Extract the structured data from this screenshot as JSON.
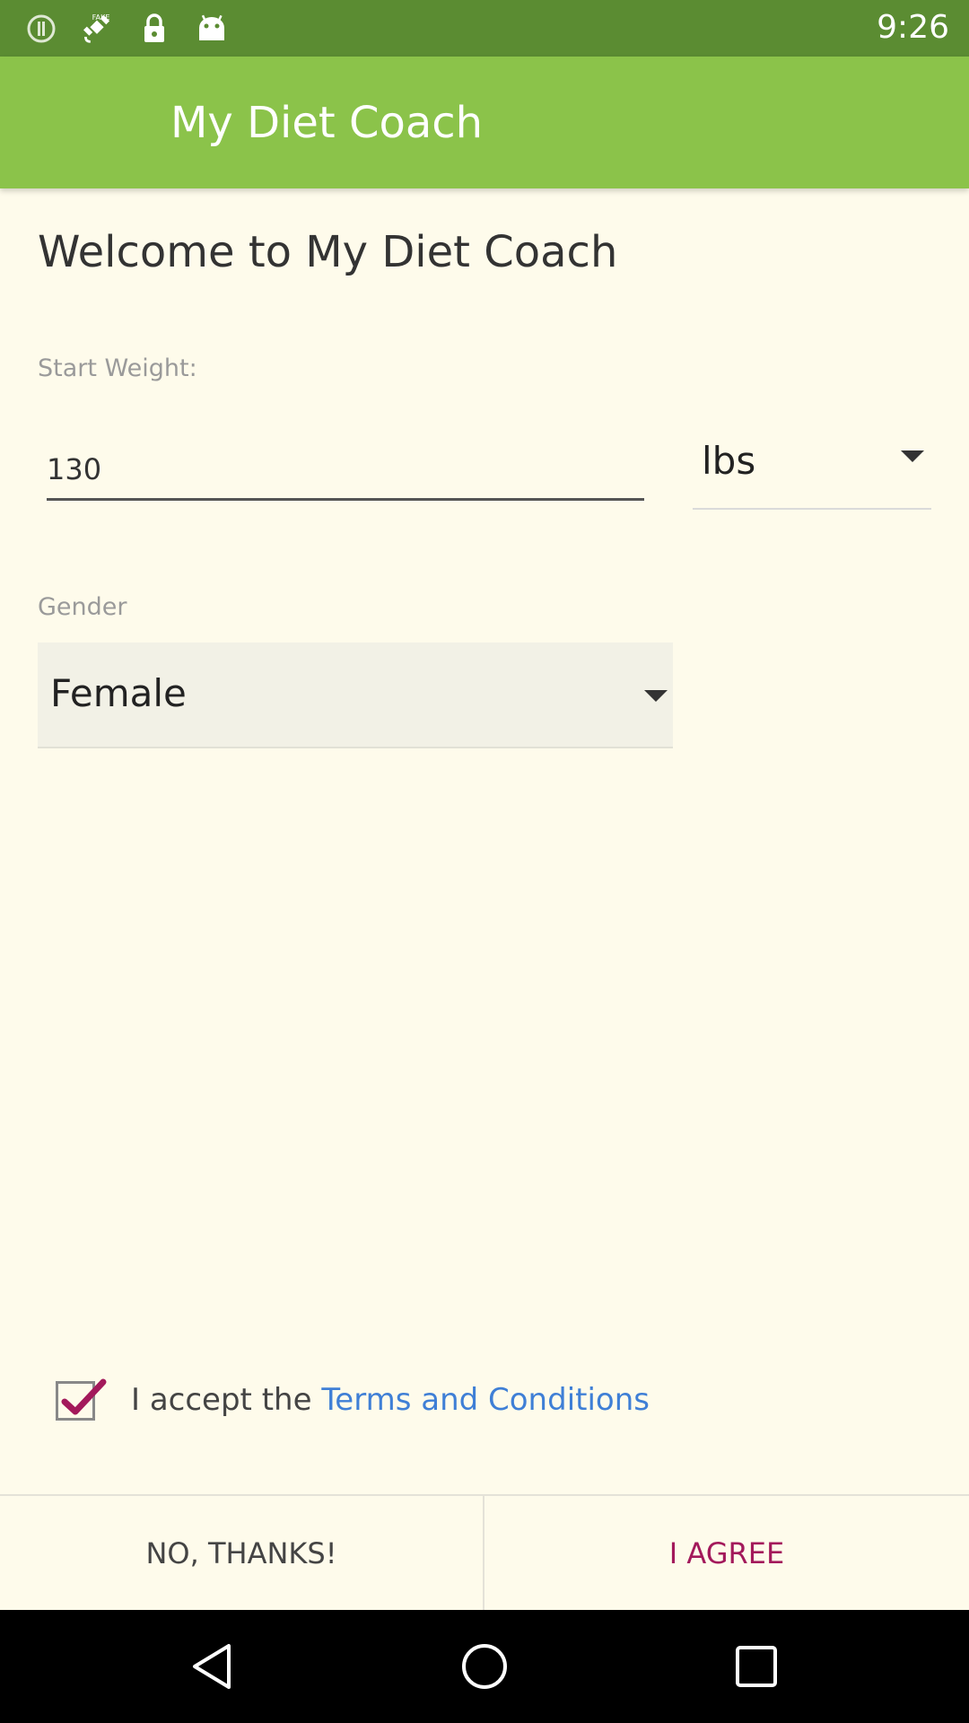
{
  "status_bar": {
    "time": "9:26",
    "icons": [
      "alert-circle-icon",
      "satellite-fake-gps-icon",
      "lock-icon",
      "android-icon"
    ]
  },
  "app_bar": {
    "title": "My Diet Coach"
  },
  "main": {
    "welcome": "Welcome to My Diet Coach",
    "start_weight": {
      "label": "Start Weight:",
      "value": "130",
      "unit": "lbs"
    },
    "gender": {
      "label": "Gender",
      "value": "Female"
    },
    "terms": {
      "checked": true,
      "prefix": "I accept the ",
      "link": "Terms and Conditions"
    }
  },
  "actions": {
    "no_label": "NO, THANKS!",
    "agree_label": "I AGREE"
  },
  "colors": {
    "status_bar": "#5b8c32",
    "app_bar": "#8bc34a",
    "background": "#fefbeb",
    "link": "#3f7fd6",
    "accent": "#a3195b"
  },
  "nav_bar": {
    "icons": [
      "back-icon",
      "home-icon",
      "recents-icon"
    ]
  }
}
